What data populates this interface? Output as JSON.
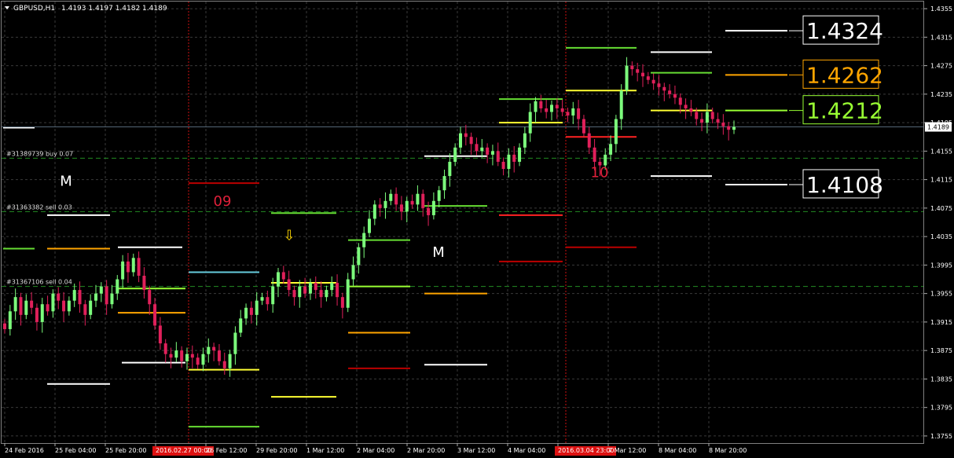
{
  "header": {
    "symbol": "GBPUSD,H1",
    "ohlc": "1.4193 1.4197 1.4182 1.4189"
  },
  "colors": {
    "background": "#000000",
    "grid": "#3a3a3a",
    "bull": "#7CFC7C",
    "bear": "#E0205A",
    "white": "#ffffff",
    "orange": "#FFA500",
    "yellow": "#FFFF33",
    "green": "#66DD33",
    "red": "#FF2222",
    "darkred": "#BB0000",
    "cyan": "#66CCDD",
    "lime": "#99FF33",
    "order_line": "#228B22"
  },
  "chart_data": {
    "type": "candlestick",
    "symbol": "GBPUSD",
    "timeframe": "H1",
    "ylim": [
      1.3745,
      1.4365
    ],
    "yticks": [
      "1.4355",
      "1.4315",
      "1.4275",
      "1.4235",
      "1.4195",
      "1.4155",
      "1.4115",
      "1.4075",
      "1.4035",
      "1.3995",
      "1.3955",
      "1.3915",
      "1.3875",
      "1.3835",
      "1.3795",
      "1.3755"
    ],
    "xticks": [
      "24 Feb 2016",
      "25 Feb 04:00",
      "25 Feb 20:00",
      "2016.02.27 00:00",
      "26 Feb 12:00",
      "29 Feb 20:00",
      "1 Mar 12:00",
      "2 Mar 04:00",
      "2 Mar 20:00",
      "3 Mar 12:00",
      "4 Mar 04:00",
      "2016.03.04 23:00",
      "7 Mar 12:00",
      "8 Mar 04:00",
      "8 Mar 20:00"
    ],
    "current_price": "1.4189",
    "closes": [
      1.3905,
      1.393,
      1.395,
      1.3925,
      1.3945,
      1.3935,
      1.3915,
      1.394,
      1.393,
      1.3955,
      1.3945,
      1.393,
      1.3945,
      1.396,
      1.394,
      1.3925,
      1.3945,
      1.3955,
      1.3965,
      1.394,
      1.3955,
      1.3975,
      1.4,
      1.3985,
      1.4005,
      1.398,
      1.396,
      1.394,
      1.391,
      1.3885,
      1.387,
      1.3865,
      1.3875,
      1.386,
      1.387,
      1.3865,
      1.3855,
      1.387,
      1.388,
      1.3875,
      1.386,
      1.385,
      1.387,
      1.39,
      1.392,
      1.3935,
      1.3925,
      1.3945,
      1.395,
      1.394,
      1.3965,
      1.3985,
      1.3975,
      1.396,
      1.395,
      1.3965,
      1.3955,
      1.397,
      1.396,
      1.395,
      1.396,
      1.397,
      1.395,
      1.3935,
      1.3975,
      1.3995,
      1.402,
      1.404,
      1.406,
      1.408,
      1.4075,
      1.4085,
      1.4095,
      1.408,
      1.407,
      1.4085,
      1.408,
      1.4095,
      1.4075,
      1.4065,
      1.4085,
      1.41,
      1.412,
      1.414,
      1.416,
      1.418,
      1.4175,
      1.4165,
      1.4155,
      1.416,
      1.415,
      1.4155,
      1.414,
      1.413,
      1.415,
      1.414,
      1.416,
      1.418,
      1.421,
      1.4225,
      1.4215,
      1.421,
      1.422,
      1.4215,
      1.421,
      1.4205,
      1.4215,
      1.42,
      1.418,
      1.416,
      1.414,
      1.4135,
      1.415,
      1.4165,
      1.42,
      1.424,
      1.4275,
      1.427,
      1.4265,
      1.426,
      1.4255,
      1.425,
      1.4245,
      1.424,
      1.4235,
      1.423,
      1.422,
      1.4215,
      1.421,
      1.42,
      1.4195,
      1.421,
      1.42,
      1.4195,
      1.419,
      1.4185,
      1.4189
    ],
    "order_lines": [
      {
        "label": "#31389739 buy 0.07",
        "price": 1.4145
      },
      {
        "label": "#31363382 sell 0.03",
        "price": 1.407
      },
      {
        "label": "#31367106 sell 0.04",
        "price": 1.3965
      }
    ],
    "zones": [
      {
        "label": "09",
        "price": 1.4075
      },
      {
        "label": "10",
        "price": 1.4115
      }
    ],
    "markers": [
      {
        "label": "M",
        "price": 1.4113
      },
      {
        "label": "M",
        "price": 1.4013
      }
    ],
    "arrow_glyph": "⇩",
    "level_labels": [
      {
        "text": "1.4324",
        "price": 1.4324,
        "color": "#ffffff",
        "border": "#ffffff"
      },
      {
        "text": "1.4262",
        "price": 1.4262,
        "color": "#FFA500",
        "border": "#FFA500"
      },
      {
        "text": "1.4212",
        "price": 1.4212,
        "color": "#99FF33",
        "border": "#99FF33"
      },
      {
        "text": "1.4108",
        "price": 1.4108,
        "color": "#ffffff",
        "border": "#ffffff"
      }
    ]
  }
}
